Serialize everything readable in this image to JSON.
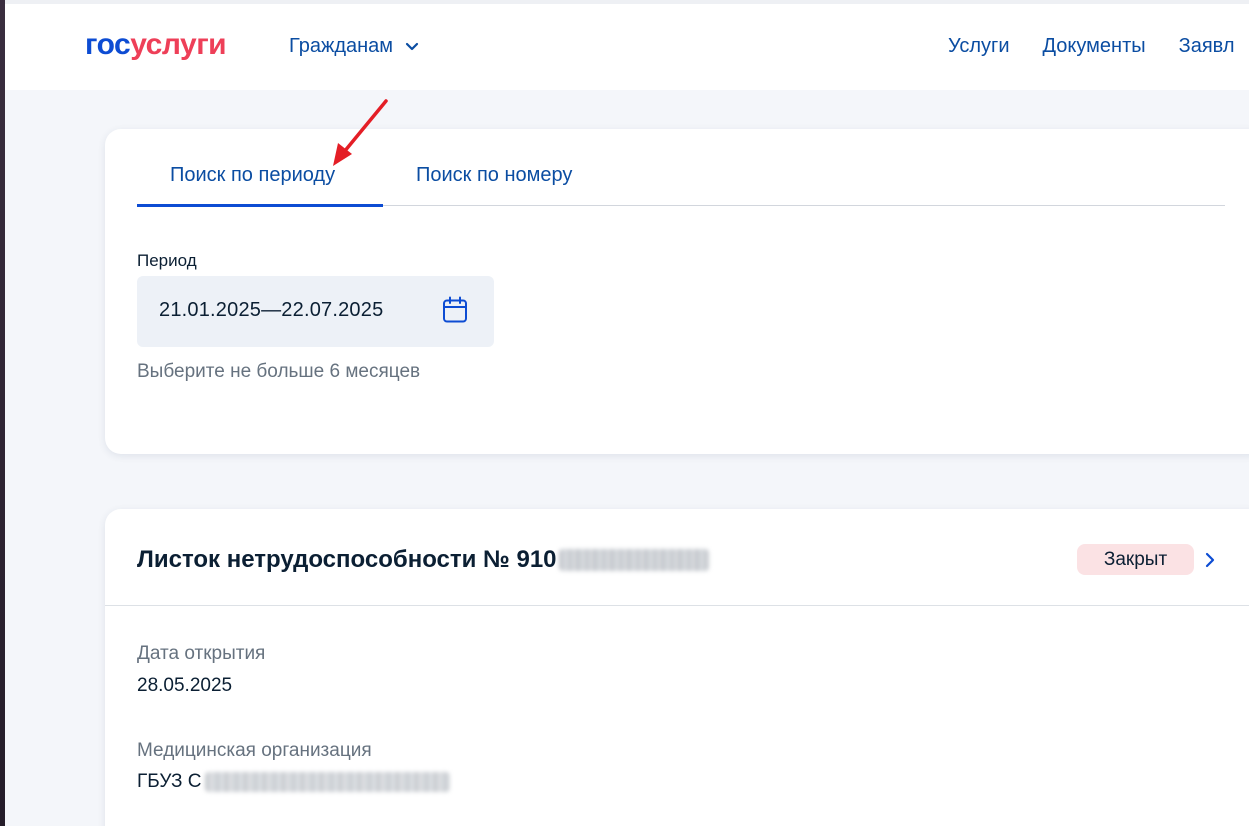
{
  "header": {
    "logo_part1": "гос",
    "logo_part2": "услуги",
    "citizens_menu": "Гражданам",
    "nav_links": [
      "Услуги",
      "Документы",
      "Заявл"
    ]
  },
  "search": {
    "tabs": [
      {
        "label": "Поиск по периоду",
        "active": true
      },
      {
        "label": "Поиск по номеру",
        "active": false
      }
    ],
    "period_label": "Период",
    "period_value": "21.01.2025—22.07.2025",
    "hint": "Выберите не больше 6 месяцев"
  },
  "sick_leave": {
    "title": "Листок нетрудоспособности № 910",
    "status": "Закрыт",
    "open_date_label": "Дата открытия",
    "open_date": "28.05.2025",
    "org_label": "Медицинская организация",
    "org_value": "ГБУЗ С"
  },
  "colors": {
    "brand_blue": "#0d4cd3",
    "brand_red": "#ee3f58",
    "link_blue": "#0b4da2",
    "annotation_arrow": "#e41e26",
    "status_badge_bg": "#fbe2e4"
  }
}
